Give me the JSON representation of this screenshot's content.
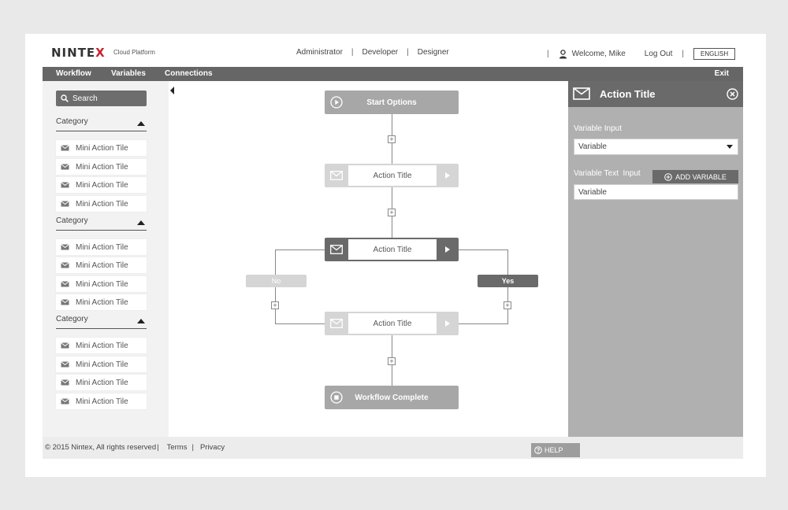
{
  "header": {
    "logo": {
      "brand_left": "NINTE",
      "brand_x": "X",
      "subtitle": "Cloud Platform"
    },
    "roles": [
      "Administrator",
      "Developer",
      "Designer"
    ],
    "welcome": "Welcome, Mike",
    "logout": "Log Out",
    "language": "ENGLISH"
  },
  "menubar": {
    "items": [
      "Workflow",
      "Variables",
      "Connections"
    ],
    "exit": "Exit"
  },
  "palette": {
    "search_label": "Search",
    "groups": [
      {
        "category": "Category",
        "tiles": [
          "Mini Action Tile",
          "Mini Action Tile",
          "Mini Action Tile",
          "Mini Action Tile"
        ]
      },
      {
        "category": "Category",
        "tiles": [
          "Mini Action Tile",
          "Mini Action Tile",
          "Mini Action Tile",
          "Mini Action Tile"
        ]
      },
      {
        "category": "Category",
        "tiles": [
          "Mini Action Tile",
          "Mini Action Tile",
          "Mini Action Tile",
          "Mini Action Tile"
        ]
      }
    ]
  },
  "canvas": {
    "start": "Start Options",
    "action1": "Action Title",
    "action2": "Action Title",
    "action3": "Action Title",
    "branch_no": "No",
    "branch_yes": "Yes",
    "complete": "Workflow Complete"
  },
  "properties": {
    "title": "Action Title",
    "variable_input_label": "Variable Input",
    "variable_input_value": "Variable",
    "variable_text_label": "Variable Text  Input",
    "add_variable": "ADD VARIABLE",
    "variable_text_value": "Variable"
  },
  "footer": {
    "copyright": "© 2015 Nintex, All rights reserved",
    "terms": "Terms",
    "privacy": "Privacy",
    "help": "HELP"
  },
  "colors": {
    "brand_red": "#c8232c",
    "menubar": "#666666",
    "panel_gray": "#b0b0b0",
    "node_light": "#d5d5d5",
    "node_dark": "#6a6a6a"
  }
}
